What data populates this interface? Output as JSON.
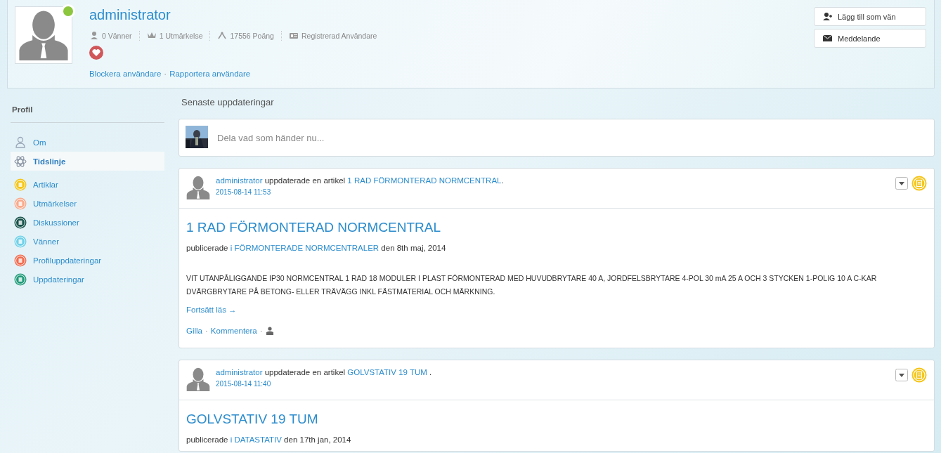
{
  "profile": {
    "name": "administrator",
    "online": true,
    "stats": [
      {
        "kind": "friends",
        "text": "0 Vänner"
      },
      {
        "kind": "award",
        "text": "1 Utmärkelse"
      },
      {
        "kind": "points",
        "text": "17556 Poäng"
      },
      {
        "kind": "card",
        "text": "Registrerad Användare"
      }
    ],
    "links": [
      "Blockera användare",
      "Rapportera användare"
    ],
    "separator": "·",
    "buttons": [
      {
        "kind": "add-friend",
        "label": "Lägg till som vän"
      },
      {
        "kind": "message",
        "label": "Meddelande"
      }
    ]
  },
  "sidebar": {
    "title": "Profil",
    "items": [
      {
        "kind": "person",
        "label": "Om",
        "selected": false
      },
      {
        "kind": "atom",
        "label": "Tidslinje",
        "selected": true
      },
      {
        "kind": "badge",
        "label": "Artiklar",
        "selected": false,
        "color": "#f5c518"
      },
      {
        "kind": "badge",
        "label": "Utmärkelser",
        "selected": false,
        "color": "#f9a98b"
      },
      {
        "kind": "badge",
        "label": "Diskussioner",
        "selected": false,
        "color": "#16524a"
      },
      {
        "kind": "badge",
        "label": "Vänner",
        "selected": false,
        "color": "#6fd0e8"
      },
      {
        "kind": "badge",
        "label": "Profiluppdateringar",
        "selected": false,
        "color": "#f26b4e"
      },
      {
        "kind": "badge",
        "label": "Uppdateringar",
        "selected": false,
        "color": "#1f9a78"
      }
    ]
  },
  "section_title": "Senaste uppdateringar",
  "composer": {
    "placeholder": "Dela vad som händer nu..."
  },
  "posts": [
    {
      "actor": "administrator",
      "verb": "uppdaterade en artikel",
      "object": "1 RAD FÖRMONTERAD NORMCENTRAL",
      "suffix": ".",
      "time": "2015-08-14 11:53",
      "title": "1 RAD FÖRMONTERAD NORMCENTRAL",
      "published": "publicerade",
      "in": "i",
      "category": "FÖRMONTERADE NORMCENTRALER",
      "date": "den 8th maj, 2014",
      "body": "VIT UTANPÅLIGGANDE IP30 NORMCENTRAL 1 RAD 18 MODULER I PLAST FÖRMONTERAD MED HUVUDBRYTARE 40 A, JORDFELSBRYTARE 4-POL 30 mA 25 A OCH 3 STYCKEN 1-POLIG 10 A C-KAR DVÄRGBRYTARE PÅ BETONG- ELLER TRÄVÄGG INKL FÄSTMATERIAL OCH MÄRKNING.",
      "more": "Fortsätt läs →",
      "actions": [
        "Gilla",
        "Kommentera"
      ]
    },
    {
      "actor": "administrator",
      "verb": "uppdaterade en artikel",
      "object": "GOLVSTATIV 19 TUM",
      "suffix": " .",
      "time": "2015-08-14 11:40",
      "title": "GOLVSTATIV 19 TUM",
      "published": "publicerade",
      "in": "i",
      "category": "DATASTATIV",
      "date": "den 17th jan, 2014"
    }
  ]
}
